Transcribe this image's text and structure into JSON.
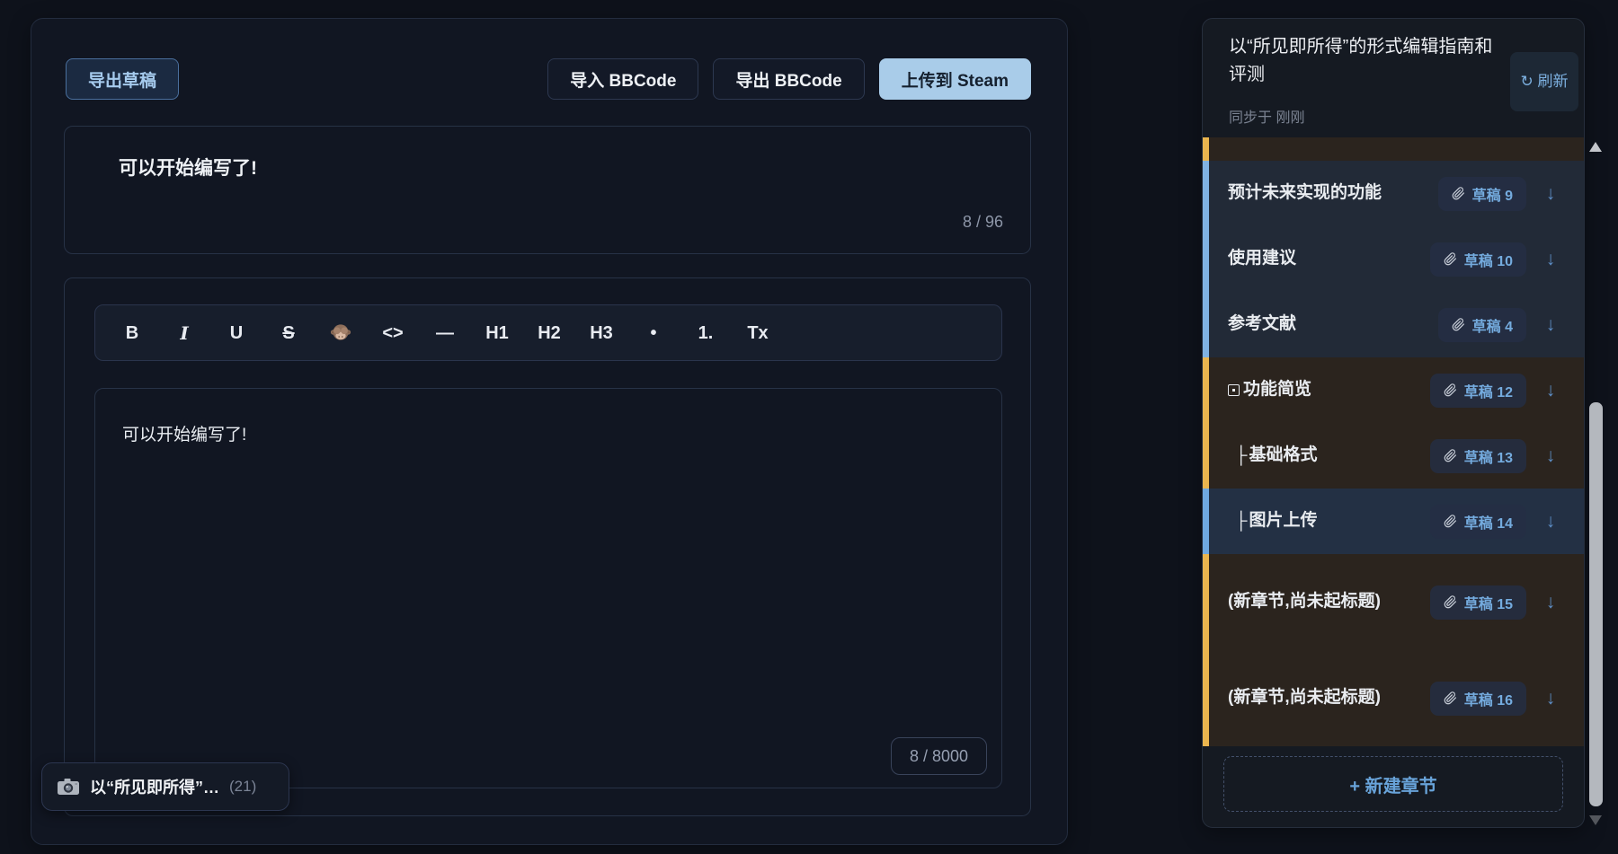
{
  "main": {
    "toolbar": {
      "export_draft": "导出草稿",
      "import_bbcode": "导入 BBCode",
      "export_bbcode": "导出 BBCode",
      "upload_steam": "上传到 Steam"
    },
    "title_editor": {
      "text": "可以开始编写了!",
      "counter": "8 / 96"
    },
    "format_toolbar": {
      "buttons": [
        {
          "name": "bold-button",
          "label": "B",
          "style": "bold"
        },
        {
          "name": "italic-button",
          "label": "I",
          "style": "italic"
        },
        {
          "name": "underline-button",
          "label": "U",
          "style": "plain"
        },
        {
          "name": "strikethrough-button",
          "label": "S",
          "style": "strike"
        },
        {
          "name": "emoji-monkey-button",
          "label": "see-no-evil-monkey",
          "style": "monkey"
        },
        {
          "name": "code-button",
          "label": "<>",
          "style": "bold"
        },
        {
          "name": "divider-button",
          "label": "—",
          "style": "plain"
        },
        {
          "name": "h1-button",
          "label": "H1",
          "style": "bold"
        },
        {
          "name": "h2-button",
          "label": "H2",
          "style": "bold"
        },
        {
          "name": "h3-button",
          "label": "H3",
          "style": "bold"
        },
        {
          "name": "bullet-list-button",
          "label": "•",
          "style": "bold"
        },
        {
          "name": "ordered-list-button",
          "label": "1.",
          "style": "bold"
        },
        {
          "name": "clear-format-button",
          "label": "Tx",
          "style": "plain"
        }
      ]
    },
    "content_editor": {
      "text": "可以开始编写了!",
      "counter": "8 / 8000"
    }
  },
  "toast": {
    "text": "以“所见即所得”…",
    "count": "(21)"
  },
  "sidebar": {
    "title": "以“所见即所得”的形式编辑指南和评测",
    "synced": "同步于 刚刚",
    "refresh_label": "↻ 刷新",
    "glyphs": {
      "branch": "├",
      "move_down": "↓"
    },
    "chapters": [
      {
        "label": "预计未来实现的功能",
        "badge": "草稿 9",
        "group": "blue",
        "prefix": "none",
        "twoline": false,
        "indent": false
      },
      {
        "label": "使用建议",
        "badge": "草稿 10",
        "group": "blue",
        "prefix": "none",
        "twoline": false,
        "indent": false
      },
      {
        "label": "参考文献",
        "badge": "草稿 4",
        "group": "blue",
        "prefix": "none",
        "twoline": false,
        "indent": false
      },
      {
        "label": "功能简览",
        "badge": "草稿 12",
        "group": "orange",
        "prefix": "box-dot",
        "twoline": false,
        "indent": false
      },
      {
        "label": "基础格式",
        "badge": "草稿 13",
        "group": "orange",
        "prefix": "branch",
        "twoline": false,
        "indent": true
      },
      {
        "label": "图片上传",
        "badge": "草稿 14",
        "group": "selected",
        "prefix": "branch",
        "twoline": false,
        "indent": true
      },
      {
        "label": "(新章节,尚未起标题)",
        "badge": "草稿 15",
        "group": "orange",
        "prefix": "none",
        "twoline": true,
        "indent": false
      },
      {
        "label": "(新章节,尚未起标题)",
        "badge": "草稿 16",
        "group": "orange",
        "prefix": "none",
        "twoline": true,
        "indent": false
      }
    ],
    "new_chapter_label": "+ 新建章节"
  }
}
